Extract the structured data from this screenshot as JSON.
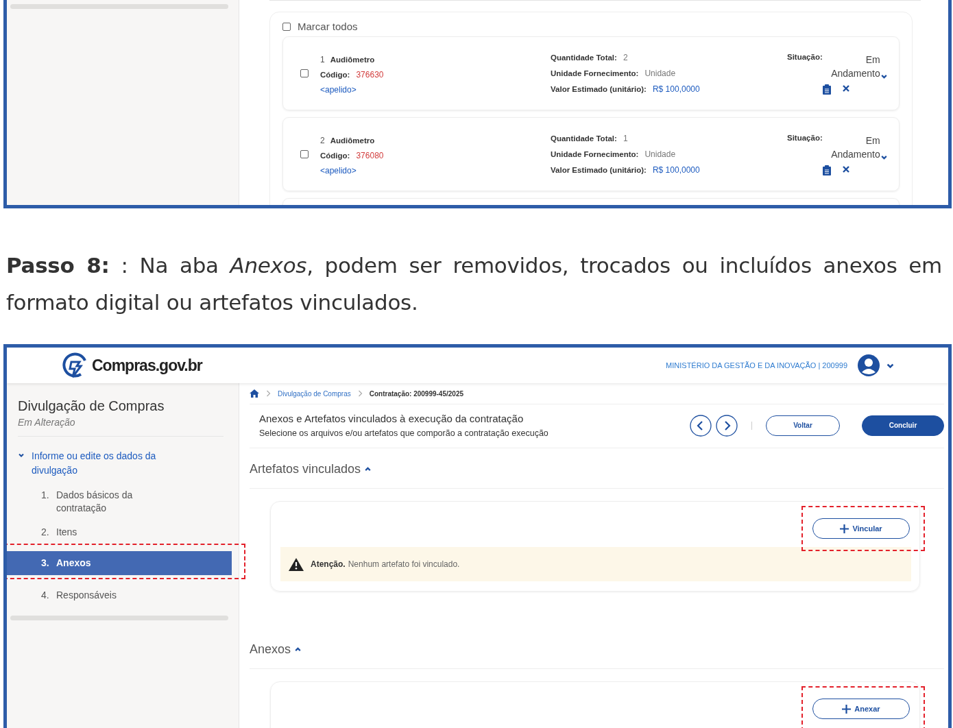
{
  "items_screen": {
    "select_all": {
      "label": "Marcar todos",
      "checked": false
    },
    "items": [
      {
        "number": "1",
        "name": "Audiômetro",
        "code_label": "Código:",
        "code": "376630",
        "nickname": "<apelido>",
        "checked": false,
        "qty_label": "Quantidade Total:",
        "qty": "2",
        "unit_label": "Unidade Fornecimento:",
        "unit": "Unidade",
        "value_label": "Valor Estimado (unitário):",
        "value": "R$ 100,0000",
        "status_label": "Situação:",
        "status": "Em Andamento"
      },
      {
        "number": "2",
        "name": "Audiômetro",
        "code_label": "Código:",
        "code": "376080",
        "nickname": "<apelido>",
        "checked": false,
        "qty_label": "Quantidade Total:",
        "qty": "1",
        "unit_label": "Unidade Fornecimento:",
        "unit": "Unidade",
        "value_label": "Valor Estimado (unitário):",
        "value": "R$ 100,0000",
        "status_label": "Situação:",
        "status": "Em Andamento"
      }
    ]
  },
  "paragraph": "**Passo 8:** : Na aba *Anexos*, podem ser removidos, trocados ou incluídos anexos em formato digital ou artefatos vinculados.",
  "attachments_screen": {
    "logo": "Compras.gov.br",
    "org": "MINISTÉRIO DA GESTÃO E DA INOVAÇÃO | 200999",
    "sidebar": {
      "title": "Divulgação de Compras",
      "subtitle": "Em Alteração",
      "section": {
        "label": "Informe ou edite os dados da divulgação",
        "expanded": true
      },
      "steps": [
        {
          "number": "1.",
          "label": "Dados básicos da contratação",
          "selected": false
        },
        {
          "number": "2.",
          "label": "Itens",
          "selected": false
        },
        {
          "number": "3.",
          "label": "Anexos",
          "selected": true
        },
        {
          "number": "4.",
          "label": "Responsáveis",
          "selected": false
        }
      ]
    },
    "breadcrumb": [
      {
        "label": "Divulgação de Compras",
        "current": false
      },
      {
        "label": "Contratação: 200999-45/2025",
        "current": true
      }
    ],
    "header": {
      "title": "Anexos e Artefatos vinculados à execução da contratação",
      "subtitle": "Selecione os arquivos e/ou artefatos que comporão a contratação execução",
      "back_button": "Voltar",
      "finish_button": "Concluir"
    },
    "sections": [
      {
        "title": "Artefatos vinculados",
        "expanded": true,
        "button": "Vincular",
        "alert": {
          "title": "Atenção.",
          "text": "Nenhum artefato foi vinculado."
        }
      },
      {
        "title": "Anexos",
        "expanded": true,
        "button": "Anexar"
      }
    ]
  }
}
